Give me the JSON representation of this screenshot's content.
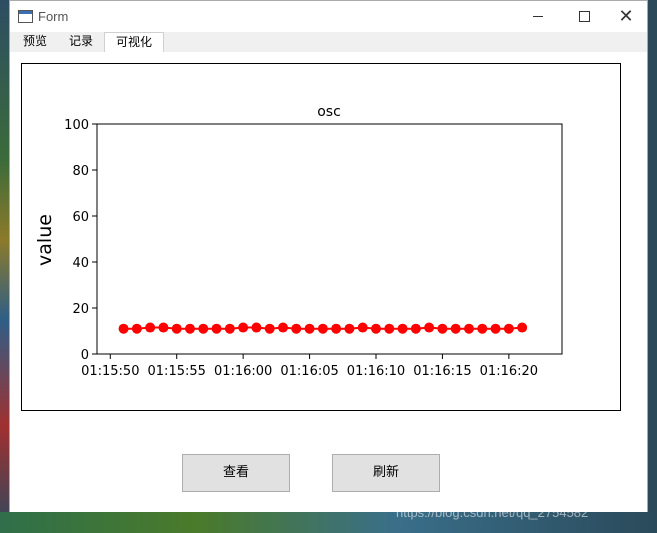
{
  "window": {
    "title": "Form"
  },
  "tabs": [
    {
      "label": "预览"
    },
    {
      "label": "记录"
    },
    {
      "label": "可视化"
    }
  ],
  "buttons": {
    "view_label": "查看",
    "refresh_label": "刷新"
  },
  "watermark": "https://blog.csdn.net/qq_2754582",
  "chart_data": {
    "type": "line",
    "title": "osc",
    "ylabel": "value",
    "ylim": [
      0,
      100
    ],
    "yticks": [
      0,
      20,
      40,
      60,
      80,
      100
    ],
    "xlim_seconds": [
      -1,
      34
    ],
    "xticks": [
      "01:15:50",
      "01:15:55",
      "01:16:00",
      "01:16:05",
      "01:16:10",
      "01:16:15",
      "01:16:20"
    ],
    "x": [
      "01:15:51",
      "01:15:52",
      "01:15:53",
      "01:15:54",
      "01:15:55",
      "01:15:56",
      "01:15:57",
      "01:15:58",
      "01:15:59",
      "01:16:00",
      "01:16:01",
      "01:16:02",
      "01:16:03",
      "01:16:04",
      "01:16:05",
      "01:16:06",
      "01:16:07",
      "01:16:08",
      "01:16:09",
      "01:16:10",
      "01:16:11",
      "01:16:12",
      "01:16:13",
      "01:16:14",
      "01:16:15",
      "01:16:16",
      "01:16:17",
      "01:16:18",
      "01:16:19",
      "01:16:20",
      "01:16:21"
    ],
    "series": [
      {
        "color": "#ff0000",
        "values": [
          11,
          11,
          11.5,
          11.5,
          11,
          11,
          11,
          11,
          11,
          11.5,
          11.5,
          11,
          11.5,
          11,
          11,
          11,
          11,
          11,
          11.5,
          11,
          11,
          11,
          11,
          11.5,
          11,
          11,
          11,
          11,
          11,
          11,
          11.5
        ]
      }
    ],
    "grid": false
  }
}
